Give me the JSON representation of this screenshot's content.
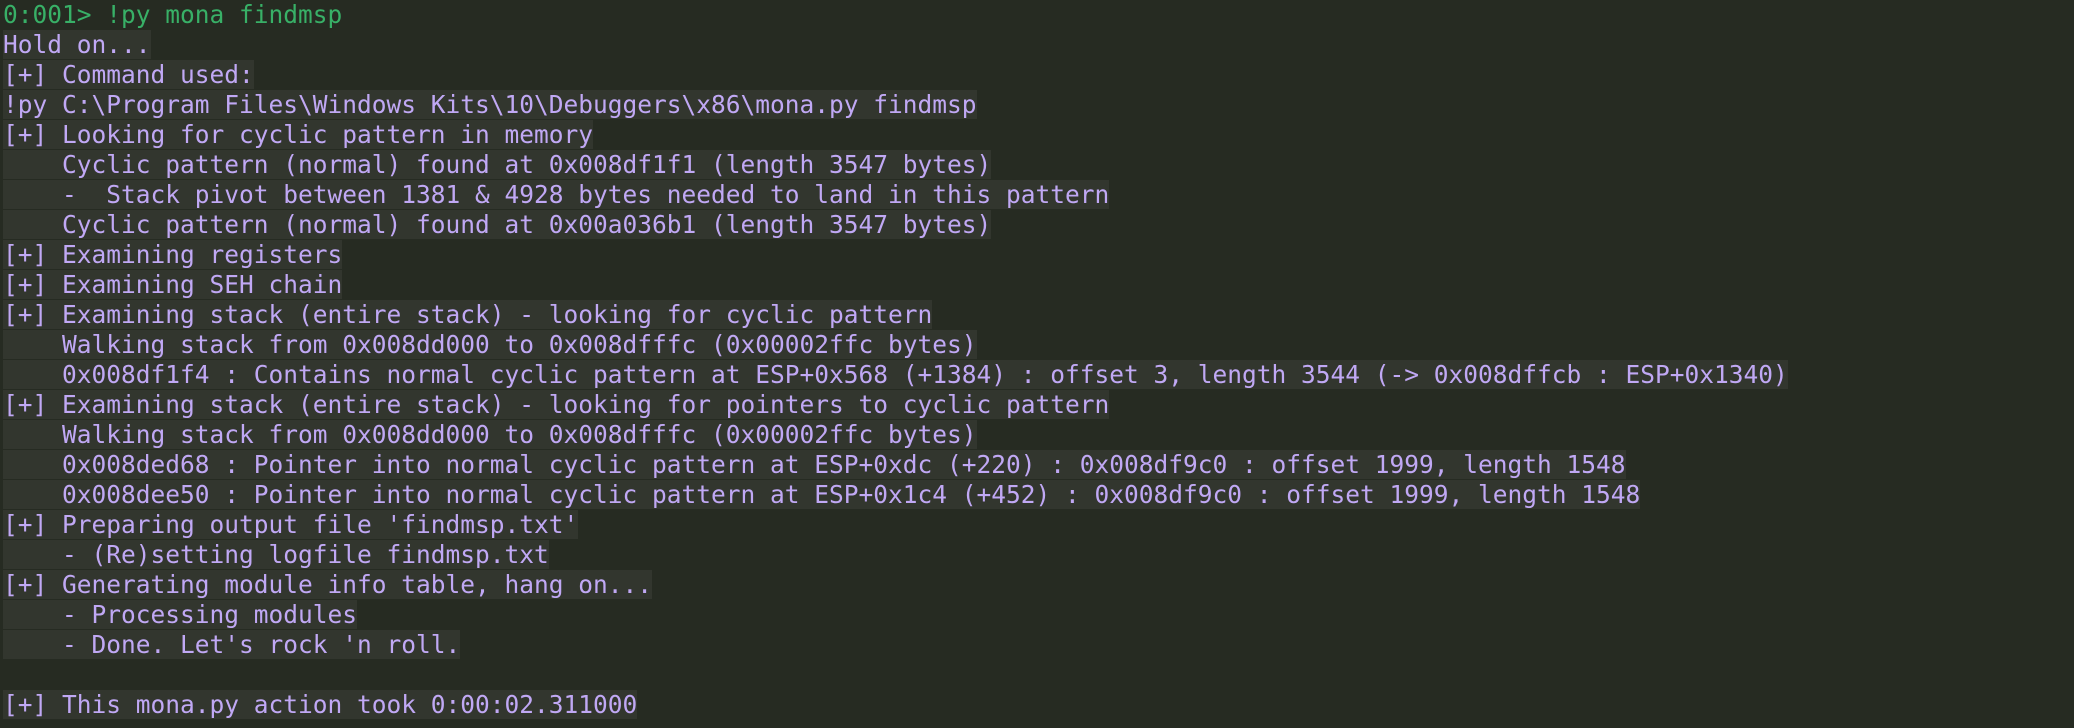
{
  "window": {
    "prompt_line": "0:001> !py mona findmsp"
  },
  "output": {
    "lines": [
      "Hold on...",
      "[+] Command used:",
      "!py C:\\Program Files\\Windows Kits\\10\\Debuggers\\x86\\mona.py findmsp",
      "[+] Looking for cyclic pattern in memory",
      "    Cyclic pattern (normal) found at 0x008df1f1 (length 3547 bytes)",
      "    -  Stack pivot between 1381 & 4928 bytes needed to land in this pattern",
      "    Cyclic pattern (normal) found at 0x00a036b1 (length 3547 bytes)",
      "[+] Examining registers",
      "[+] Examining SEH chain",
      "[+] Examining stack (entire stack) - looking for cyclic pattern",
      "    Walking stack from 0x008dd000 to 0x008dfffc (0x00002ffc bytes)",
      "    0x008df1f4 : Contains normal cyclic pattern at ESP+0x568 (+1384) : offset 3, length 3544 (-> 0x008dffcb : ESP+0x1340)",
      "[+] Examining stack (entire stack) - looking for pointers to cyclic pattern",
      "    Walking stack from 0x008dd000 to 0x008dfffc (0x00002ffc bytes)",
      "    0x008ded68 : Pointer into normal cyclic pattern at ESP+0xdc (+220) : 0x008df9c0 : offset 1999, length 1548",
      "    0x008dee50 : Pointer into normal cyclic pattern at ESP+0x1c4 (+452) : 0x008df9c0 : offset 1999, length 1548",
      "[+] Preparing output file 'findmsp.txt'",
      "    - (Re)setting logfile findmsp.txt",
      "[+] Generating module info table, hang on...",
      "    - Processing modules",
      "    - Done. Let's rock 'n roll.",
      "",
      "[+] This mona.py action took 0:00:02.311000"
    ]
  },
  "colors": {
    "background": "#262b22",
    "prompt_text": "#38b067",
    "output_text": "#c0a8f4",
    "output_highlight": "#32362e"
  }
}
